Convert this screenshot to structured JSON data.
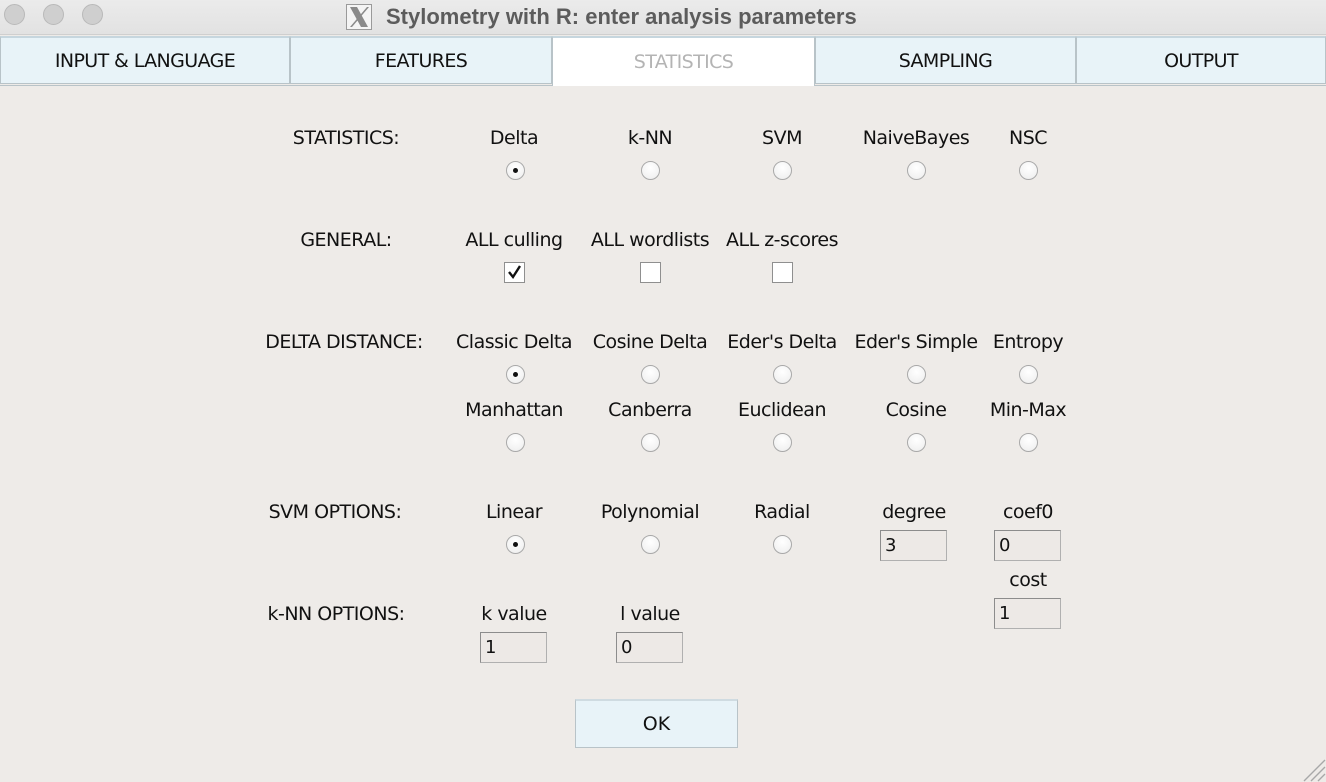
{
  "window": {
    "title": "Stylometry with R: enter analysis parameters",
    "app_icon": "x11-icon"
  },
  "tabs": [
    {
      "label": "INPUT & LANGUAGE",
      "active": false
    },
    {
      "label": "FEATURES",
      "active": false
    },
    {
      "label": "STATISTICS",
      "active": true
    },
    {
      "label": "SAMPLING",
      "active": false
    },
    {
      "label": "OUTPUT",
      "active": false
    }
  ],
  "statistics": {
    "label": "STATISTICS:",
    "options": [
      {
        "label": "Delta",
        "selected": true
      },
      {
        "label": "k-NN",
        "selected": false
      },
      {
        "label": "SVM",
        "selected": false
      },
      {
        "label": "NaiveBayes",
        "selected": false
      },
      {
        "label": "NSC",
        "selected": false
      }
    ]
  },
  "general": {
    "label": "GENERAL:",
    "options": [
      {
        "label": "ALL culling",
        "checked": true
      },
      {
        "label": "ALL wordlists",
        "checked": false
      },
      {
        "label": "ALL z-scores",
        "checked": false
      }
    ]
  },
  "delta_distance": {
    "label": "DELTA DISTANCE:",
    "row1": [
      {
        "label": "Classic Delta",
        "selected": true
      },
      {
        "label": "Cosine Delta",
        "selected": false
      },
      {
        "label": "Eder's Delta",
        "selected": false
      },
      {
        "label": "Eder's Simple",
        "selected": false
      },
      {
        "label": "Entropy",
        "selected": false
      }
    ],
    "row2": [
      {
        "label": "Manhattan",
        "selected": false
      },
      {
        "label": "Canberra",
        "selected": false
      },
      {
        "label": "Euclidean",
        "selected": false
      },
      {
        "label": "Cosine",
        "selected": false
      },
      {
        "label": "Min-Max",
        "selected": false
      }
    ]
  },
  "svm_options": {
    "label": "SVM OPTIONS:",
    "kernels": [
      {
        "label": "Linear",
        "selected": true
      },
      {
        "label": "Polynomial",
        "selected": false
      },
      {
        "label": "Radial",
        "selected": false
      }
    ],
    "degree": {
      "label": "degree",
      "value": "3"
    },
    "coef0": {
      "label": "coef0",
      "value": "0"
    },
    "cost": {
      "label": "cost",
      "value": "1"
    }
  },
  "knn_options": {
    "label": "k-NN OPTIONS:",
    "k": {
      "label": "k value",
      "value": "1"
    },
    "l": {
      "label": "l value",
      "value": "0"
    }
  },
  "ok_button": {
    "label": "OK"
  }
}
